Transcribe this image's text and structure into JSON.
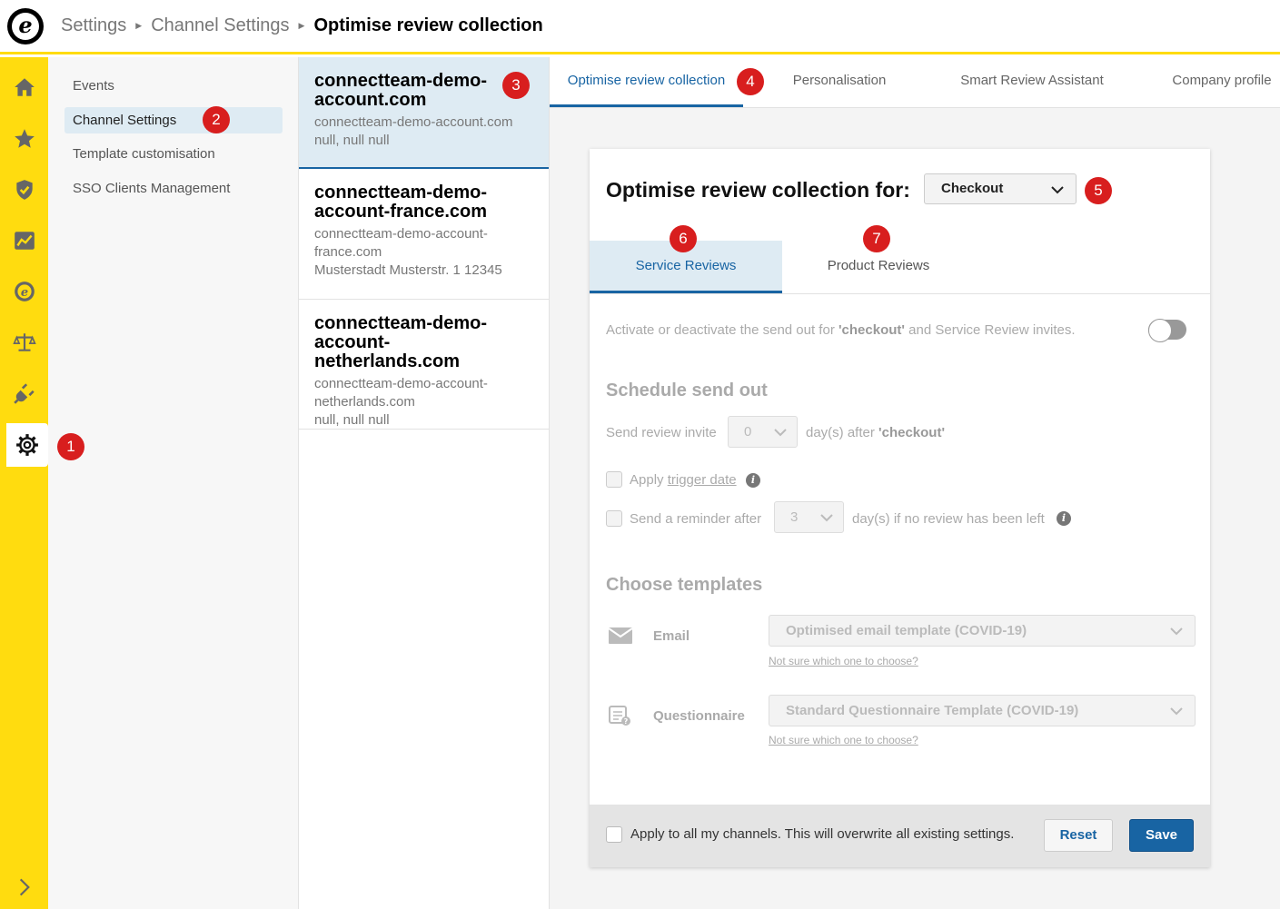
{
  "breadcrumb": {
    "items": [
      "Settings",
      "Channel Settings"
    ],
    "current": "Optimise review collection"
  },
  "logo": {
    "letter": "e"
  },
  "rail": {
    "icons": [
      "home-icon",
      "star-icon",
      "shield-check-icon",
      "chart-icon",
      "trusted-shops-icon",
      "scales-icon",
      "plug-icon",
      "gear-icon",
      "chevron-right-icon"
    ],
    "active": "gear-icon",
    "color": "#ffdc0f"
  },
  "badges": [
    "1",
    "2",
    "3",
    "4",
    "5",
    "6",
    "7"
  ],
  "nav": {
    "items": [
      "Events",
      "Channel Settings",
      "Template customisation",
      "SSO Clients Management"
    ],
    "active": "Channel Settings"
  },
  "channels": [
    {
      "name": "connectteam-demo-account.com",
      "domain": "connectteam-demo-account.com",
      "address": "null, null null"
    },
    {
      "name": "connectteam-demo-account-france.com",
      "domain": "connectteam-demo-account-france.com",
      "address": "Musterstadt Musterstr. 1 12345"
    },
    {
      "name": "connectteam-demo-account-netherlands.com",
      "domain": "connectteam-demo-account-netherlands.com",
      "address": "null, null null"
    }
  ],
  "tabs": [
    "Optimise review collection",
    "Personalisation",
    "Smart Review Assistant",
    "Company profile"
  ],
  "card": {
    "title": "Optimise review collection for:",
    "event_select": "Checkout",
    "subtabs": [
      "Service Reviews",
      "Product Reviews"
    ],
    "activate_text_1": "Activate or deactivate the send out for ",
    "activate_event": "'checkout'",
    "activate_text_2": " and Service Review invites.",
    "toggle_on": false,
    "schedule_heading": "Schedule send out",
    "send_invite_label": "Send review invite",
    "send_invite_days": "0",
    "days_after": "day(s) after ",
    "days_after_event": "'checkout'",
    "apply_trigger_prefix": "Apply ",
    "apply_trigger_link": "trigger date",
    "reminder_label": "Send a reminder after",
    "reminder_days": "3",
    "reminder_suffix": "day(s) if no review has been left",
    "templates_heading": "Choose templates",
    "email_label": "Email",
    "email_template": "Optimised email template (COVID-19)",
    "questionnaire_label": "Questionnaire",
    "questionnaire_template": "Standard Questionnaire Template (COVID-19)",
    "help_link": "Not sure which one to choose?",
    "info_glyph": "i"
  },
  "footer": {
    "apply_all": "Apply to all my channels. This will overwrite all existing settings.",
    "reset": "Reset",
    "save": "Save"
  },
  "colors": {
    "accent": "#1864a3",
    "brand_yellow": "#ffdc0f",
    "badge_red": "#d81e1e",
    "selected_bg": "#deebf3"
  }
}
